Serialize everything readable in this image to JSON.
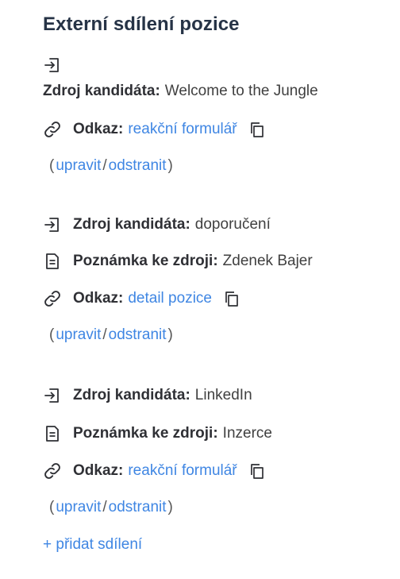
{
  "title": "Externí sdílení pozice",
  "labels": {
    "source": "Zdroj kandidáta:",
    "note": "Poznámka ke zdroji:",
    "link": "Odkaz:"
  },
  "entries": [
    {
      "source": "Welcome to the Jungle",
      "link_text": "reakční formulář",
      "edit": "upravit",
      "separator": "/",
      "remove": "odstranit"
    },
    {
      "source": "doporučení",
      "note": "Zdenek Bajer",
      "link_text": "detail pozice",
      "edit": "upravit",
      "separator": "/",
      "remove": "odstranit"
    },
    {
      "source": "LinkedIn",
      "note": "Inzerce",
      "link_text": "reakční formulář",
      "edit": "upravit",
      "separator": "/",
      "remove": "odstranit"
    }
  ],
  "add_share": "+ přidat sdílení",
  "paren_open": "(",
  "paren_close": ")",
  "icons": {
    "source": "login-icon",
    "note": "document-icon",
    "link": "link-icon",
    "copy": "copy-icon"
  },
  "colors": {
    "title": "#263346",
    "link": "#3f86e3"
  }
}
